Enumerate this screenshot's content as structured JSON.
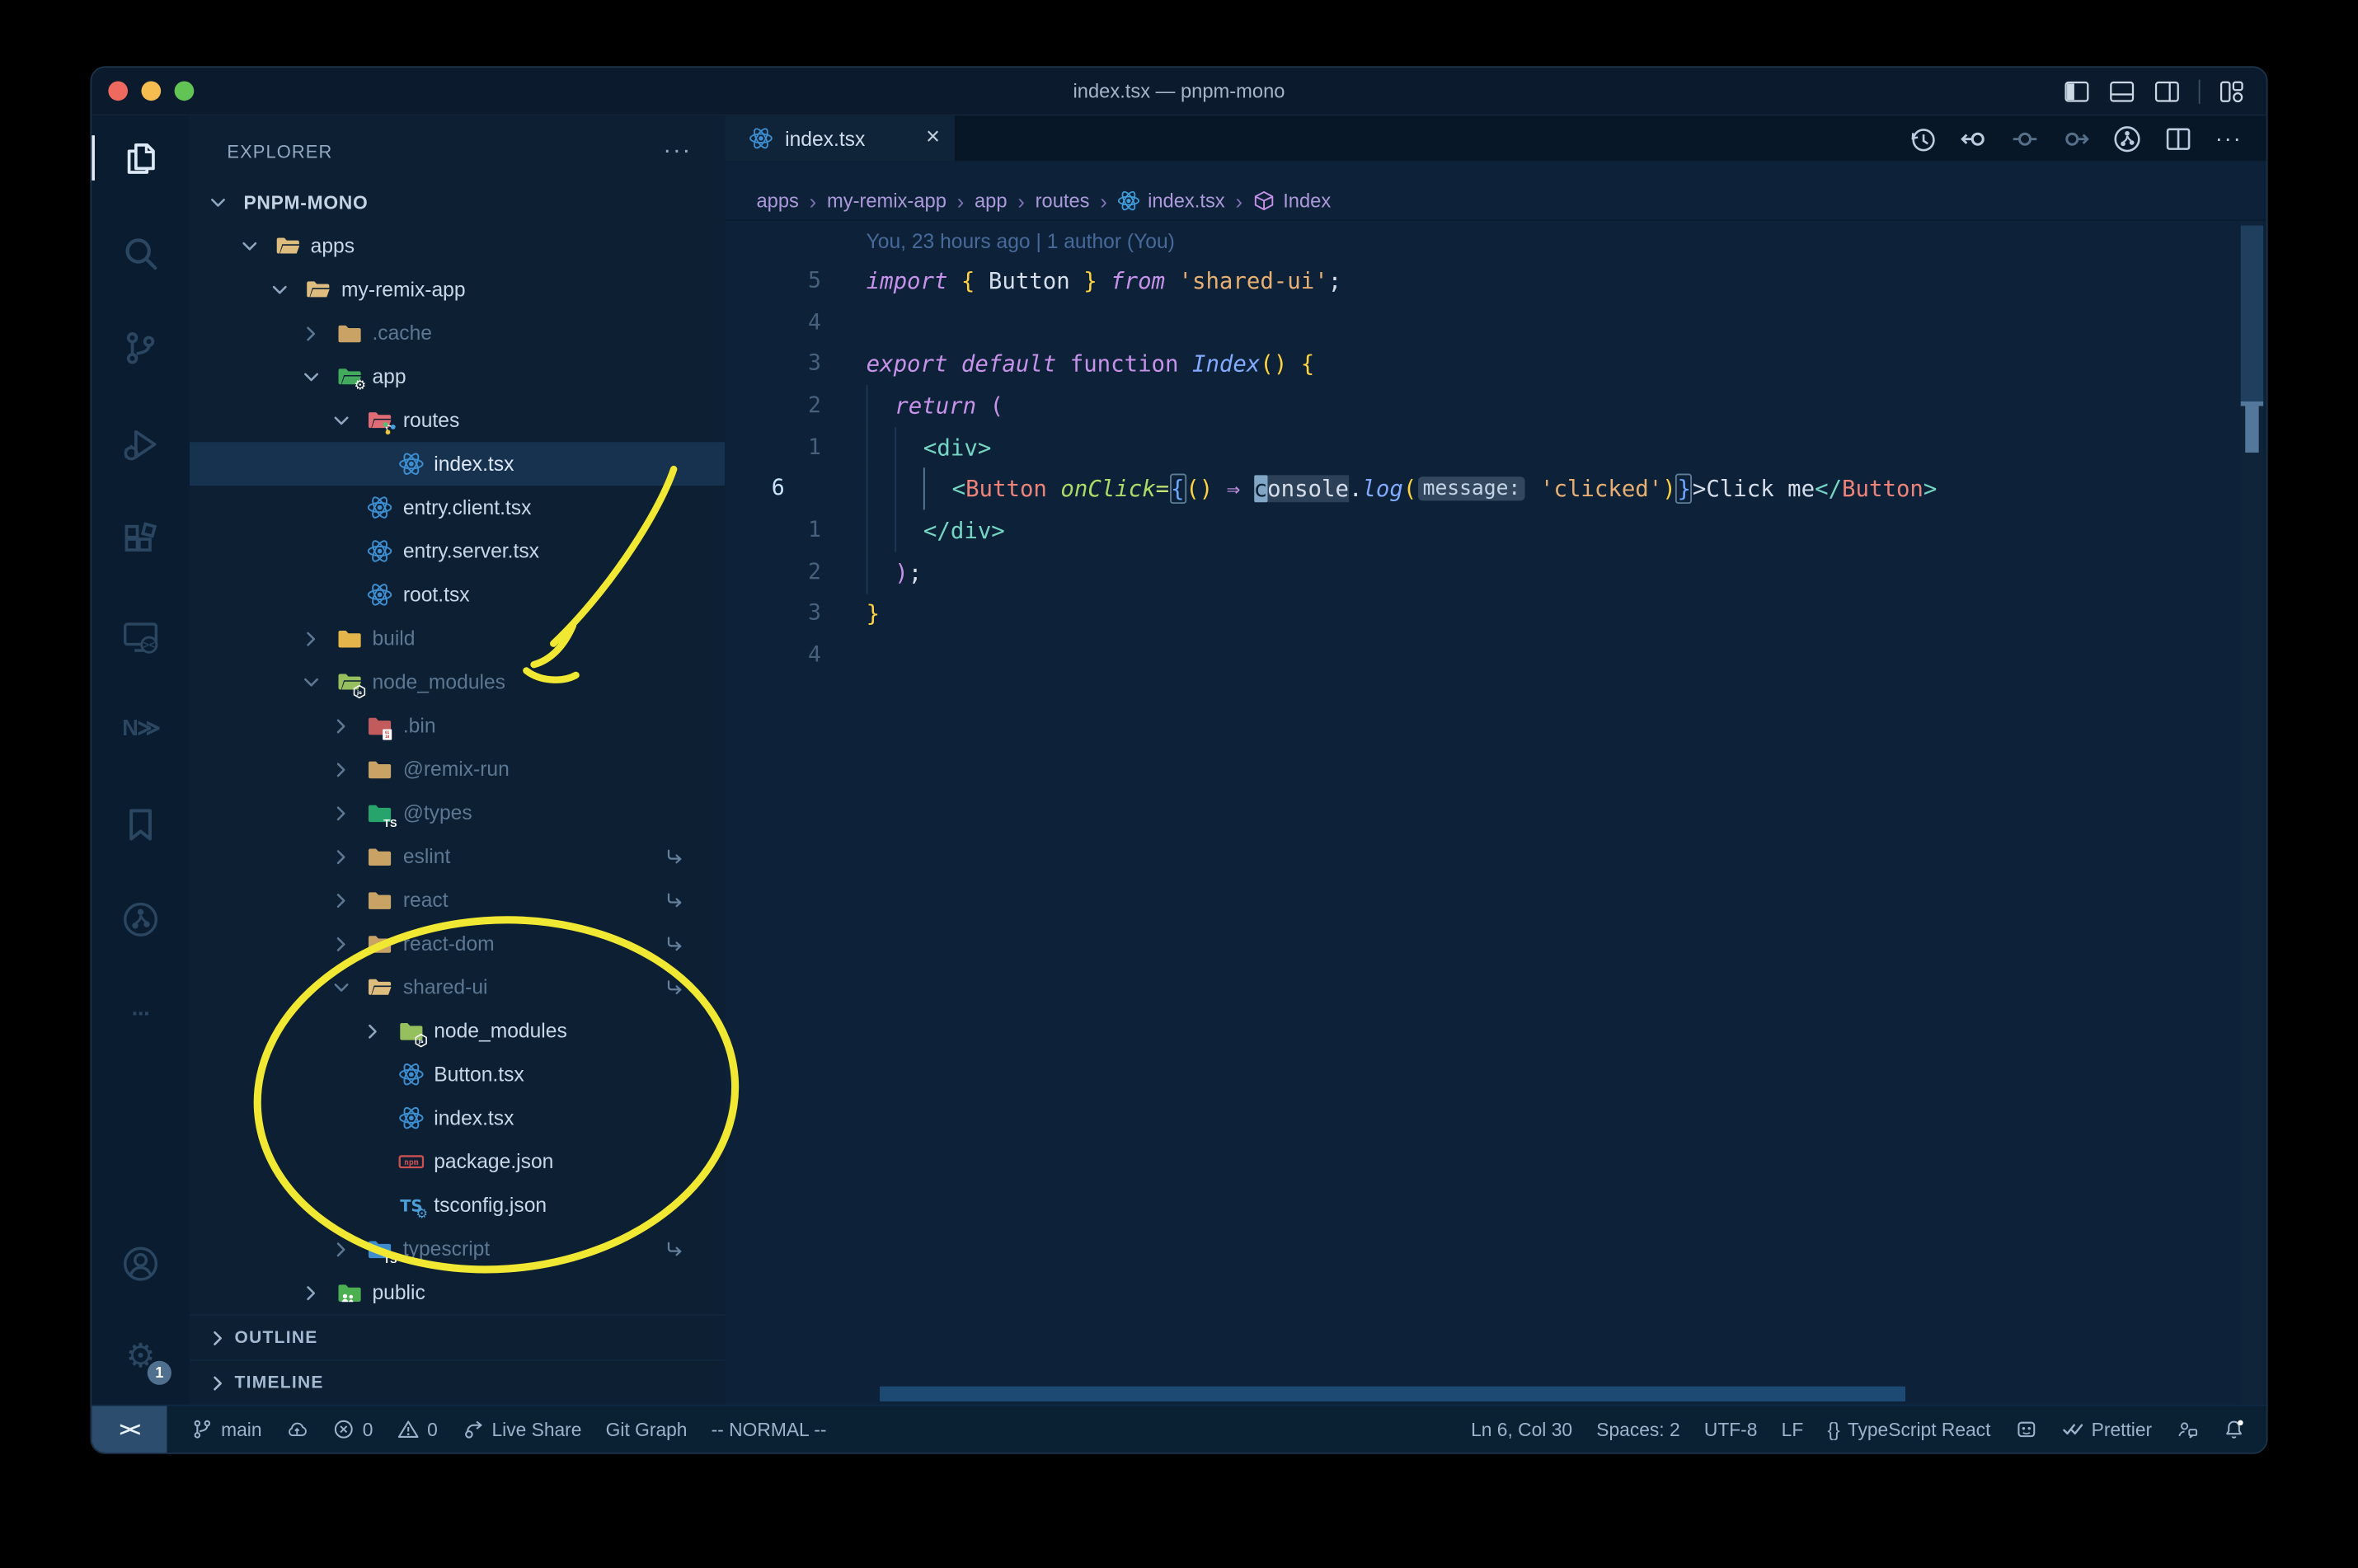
{
  "window": {
    "title": "index.tsx — pnpm-mono",
    "traffic_lights": [
      "close",
      "minimize",
      "zoom"
    ],
    "layout_controls": [
      {
        "name": "toggle-primary-sidebar",
        "icon": "panel-left"
      },
      {
        "name": "toggle-panel",
        "icon": "panel-bottom"
      },
      {
        "name": "toggle-secondary-sidebar",
        "icon": "panel-right"
      },
      {
        "name": "customize-layout",
        "icon": "layout"
      }
    ]
  },
  "activity_bar": {
    "items": [
      {
        "name": "explorer",
        "icon": "files",
        "active": true
      },
      {
        "name": "search",
        "icon": "search",
        "active": false
      },
      {
        "name": "source-control",
        "icon": "scm",
        "active": false
      },
      {
        "name": "run-and-debug",
        "icon": "debug",
        "active": false
      },
      {
        "name": "extensions",
        "icon": "extensions",
        "active": false
      },
      {
        "name": "remote-explorer",
        "icon": "remote",
        "active": false
      },
      {
        "name": "nx-console",
        "icon": "nx",
        "active": false,
        "text": "N≫"
      },
      {
        "name": "bookmarks",
        "icon": "bookmark",
        "active": false
      },
      {
        "name": "gitlens",
        "icon": "gitlens",
        "active": false
      },
      {
        "name": "additional-views",
        "icon": "ellipsis",
        "active": false
      }
    ],
    "bottom_items": [
      {
        "name": "accounts",
        "icon": "account"
      },
      {
        "name": "settings",
        "icon": "gear",
        "badge": "1"
      }
    ]
  },
  "sidebar": {
    "title": "EXPLORER",
    "tree": [
      {
        "label": "PNPM-MONO",
        "level": 0,
        "chevron": "down",
        "root": true
      },
      {
        "label": "apps",
        "level": 1,
        "chevron": "down",
        "icon": {
          "base": "folder-open",
          "color": "#debc7d"
        }
      },
      {
        "label": "my-remix-app",
        "level": 2,
        "chevron": "down",
        "icon": {
          "base": "folder-open",
          "color": "#debc7d"
        }
      },
      {
        "label": ".cache",
        "level": 3,
        "chevron": "right",
        "dim": true,
        "icon": {
          "base": "folder",
          "color": "#c9a265"
        }
      },
      {
        "label": "app",
        "level": 3,
        "chevron": "down",
        "icon": {
          "base": "folder-open",
          "color": "#43a95c",
          "badge": "gear"
        }
      },
      {
        "label": "routes",
        "level": 4,
        "chevron": "down",
        "icon": {
          "base": "folder-open",
          "color": "#e06c75",
          "badge": "routes"
        }
      },
      {
        "label": "index.tsx",
        "level": 5,
        "chevron": "none",
        "selected": true,
        "icon": {
          "base": "react",
          "color": "#3d8fd1"
        }
      },
      {
        "label": "entry.client.tsx",
        "level": 4,
        "chevron": "none",
        "icon": {
          "base": "react",
          "color": "#3d8fd1"
        }
      },
      {
        "label": "entry.server.tsx",
        "level": 4,
        "chevron": "none",
        "icon": {
          "base": "react",
          "color": "#3d8fd1"
        }
      },
      {
        "label": "root.tsx",
        "level": 4,
        "chevron": "none",
        "icon": {
          "base": "react",
          "color": "#3d8fd1"
        }
      },
      {
        "label": "build",
        "level": 3,
        "chevron": "right",
        "dim": true,
        "icon": {
          "base": "folder",
          "color": "#e3b54b"
        }
      },
      {
        "label": "node_modules",
        "level": 3,
        "chevron": "down",
        "dim": true,
        "icon": {
          "base": "folder-open",
          "color": "#96c05e",
          "badge": "js"
        }
      },
      {
        "label": ".bin",
        "level": 4,
        "chevron": "right",
        "dim": true,
        "icon": {
          "base": "folder",
          "color": "#c25b5b",
          "badge": "binary"
        }
      },
      {
        "label": "@remix-run",
        "level": 4,
        "chevron": "right",
        "dim": true,
        "icon": {
          "base": "folder",
          "color": "#c9a265"
        }
      },
      {
        "label": "@types",
        "level": 4,
        "chevron": "right",
        "dim": true,
        "icon": {
          "base": "folder",
          "color": "#27a36c",
          "badge": "ts"
        }
      },
      {
        "label": "eslint",
        "level": 4,
        "chevron": "right",
        "dim": true,
        "symlink": true,
        "icon": {
          "base": "folder",
          "color": "#c9a265"
        }
      },
      {
        "label": "react",
        "level": 4,
        "chevron": "right",
        "dim": true,
        "symlink": true,
        "icon": {
          "base": "folder",
          "color": "#c9a265"
        }
      },
      {
        "label": "react-dom",
        "level": 4,
        "chevron": "right",
        "dim": true,
        "symlink": true,
        "icon": {
          "base": "folder",
          "color": "#c9a265"
        }
      },
      {
        "label": "shared-ui",
        "level": 4,
        "chevron": "down",
        "dim": true,
        "symlink": true,
        "icon": {
          "base": "folder-open",
          "color": "#debc7d"
        }
      },
      {
        "label": "node_modules",
        "level": 5,
        "chevron": "right",
        "icon": {
          "base": "folder",
          "color": "#96c05e",
          "badge": "js"
        }
      },
      {
        "label": "Button.tsx",
        "level": 5,
        "chevron": "none",
        "icon": {
          "base": "react",
          "color": "#3d8fd1"
        }
      },
      {
        "label": "index.tsx",
        "level": 5,
        "chevron": "none",
        "icon": {
          "base": "react",
          "color": "#3d8fd1"
        }
      },
      {
        "label": "package.json",
        "level": 5,
        "chevron": "none",
        "icon": {
          "base": "npm",
          "color": "#cb5151"
        }
      },
      {
        "label": "tsconfig.json",
        "level": 5,
        "chevron": "none",
        "icon": {
          "base": "tsletters",
          "color": "#4d9fd6",
          "badge": "gear-blue"
        }
      },
      {
        "label": "typescript",
        "level": 4,
        "chevron": "right",
        "dim": true,
        "symlink": true,
        "icon": {
          "base": "folder",
          "color": "#3f8ccc",
          "badge": "ts"
        }
      },
      {
        "label": "public",
        "level": 3,
        "chevron": "right",
        "icon": {
          "base": "folder",
          "color": "#4caf50",
          "badge": "people"
        }
      }
    ],
    "sections": [
      {
        "label": "OUTLINE"
      },
      {
        "label": "TIMELINE"
      }
    ]
  },
  "editor": {
    "tab": {
      "label": "index.tsx",
      "close": "×"
    },
    "actions": [
      {
        "name": "local-history",
        "icon": "history",
        "dim": false
      },
      {
        "name": "previous-change",
        "icon": "chg-prev",
        "dim": false
      },
      {
        "name": "open-changes",
        "icon": "chg",
        "dim": true
      },
      {
        "name": "next-change",
        "icon": "chg-next",
        "dim": true
      },
      {
        "name": "gitlens-graph",
        "icon": "gitlens",
        "dim": false
      },
      {
        "name": "split-editor",
        "icon": "split",
        "dim": false
      },
      {
        "name": "more-actions",
        "icon": "ellipsis",
        "dim": false
      }
    ],
    "breadcrumbs": [
      {
        "label": "apps"
      },
      {
        "label": "my-remix-app"
      },
      {
        "label": "app"
      },
      {
        "label": "routes"
      },
      {
        "label": "index.tsx",
        "icon": "react"
      },
      {
        "label": "Index",
        "icon": "cube"
      }
    ],
    "blame": "You, 23 hours ago | 1 author (You)",
    "code": [
      {
        "num": "5",
        "guides": 0,
        "tokens": [
          [
            "import",
            "kw"
          ],
          [
            " ",
            "pl"
          ],
          [
            "{",
            "by"
          ],
          [
            " ",
            "pl"
          ],
          [
            "Button",
            "pl"
          ],
          [
            " ",
            "pl"
          ],
          [
            "}",
            "by"
          ],
          [
            " ",
            "pl"
          ],
          [
            "from",
            "kw"
          ],
          [
            " ",
            "pl"
          ],
          [
            "'shared-ui'",
            "str"
          ],
          [
            ";",
            "pl"
          ]
        ]
      },
      {
        "num": "4",
        "guides": 0,
        "tokens": []
      },
      {
        "num": "3",
        "guides": 0,
        "tokens": [
          [
            "export",
            "kw"
          ],
          [
            " ",
            "pl"
          ],
          [
            "default",
            "kw"
          ],
          [
            " ",
            "pl"
          ],
          [
            "function",
            "kwf"
          ],
          [
            " ",
            "pl"
          ],
          [
            "Index",
            "fn"
          ],
          [
            "()",
            "by"
          ],
          [
            " ",
            "pl"
          ],
          [
            "{",
            "by"
          ]
        ]
      },
      {
        "num": "2",
        "guides": 1,
        "tokens": [
          [
            "return",
            "kw"
          ],
          [
            " ",
            "pl"
          ],
          [
            "(",
            "bm"
          ]
        ]
      },
      {
        "num": "1",
        "guides": 2,
        "tokens": [
          [
            "<div>",
            "tag"
          ]
        ]
      },
      {
        "num": "6",
        "current": true,
        "guides": 3,
        "tokens": [
          [
            "<",
            "tag"
          ],
          [
            "Button",
            "cmp"
          ],
          [
            " ",
            "pl"
          ],
          [
            "onClick",
            "attr"
          ],
          [
            "=",
            "eq"
          ],
          [
            "{",
            "bbx"
          ],
          [
            "()",
            "by"
          ],
          [
            " ",
            "pl"
          ],
          [
            "⇒",
            "arrow"
          ],
          [
            " ",
            "pl"
          ],
          [
            "c",
            "cursor"
          ],
          [
            "onsole",
            "whl"
          ],
          [
            ".",
            "pl"
          ],
          [
            "log",
            "fn"
          ],
          [
            "(",
            "by"
          ],
          [
            "message:",
            "inlay"
          ],
          [
            " ",
            "pl"
          ],
          [
            "'clicked'",
            "str"
          ],
          [
            ")",
            "by"
          ],
          [
            "}",
            "bbx"
          ],
          [
            ">",
            "pl"
          ],
          [
            "Click me",
            "pl"
          ],
          [
            "</",
            "tag"
          ],
          [
            "Button",
            "cmp"
          ],
          [
            ">",
            "tag"
          ]
        ]
      },
      {
        "num": "1",
        "guides": 2,
        "tokens": [
          [
            "</div>",
            "tag"
          ]
        ]
      },
      {
        "num": "2",
        "guides": 1,
        "tokens": [
          [
            ")",
            "bm"
          ],
          [
            ";",
            "pl"
          ]
        ]
      },
      {
        "num": "3",
        "guides": 0,
        "tokens": [
          [
            "}",
            "by"
          ]
        ]
      },
      {
        "num": "4",
        "guides": 0,
        "tokens": []
      }
    ]
  },
  "status_bar": {
    "left": [
      {
        "name": "remote",
        "icon": "remote-indicator",
        "label": "><",
        "box": true
      },
      {
        "name": "git-branch",
        "icon": "branch",
        "label": "main"
      },
      {
        "name": "publish-changes",
        "icon": "cloud-upload",
        "label": ""
      },
      {
        "name": "errors",
        "icon": "error-circle",
        "label": "0"
      },
      {
        "name": "warnings",
        "icon": "warning-triangle",
        "label": "0"
      },
      {
        "name": "live-share",
        "icon": "live-share",
        "label": "Live Share"
      },
      {
        "name": "git-graph",
        "icon": "",
        "label": "Git Graph"
      },
      {
        "name": "vim-mode",
        "icon": "",
        "label": "-- NORMAL --"
      }
    ],
    "right": [
      {
        "name": "cursor-position",
        "icon": "",
        "label": "Ln 6, Col 30"
      },
      {
        "name": "indentation",
        "icon": "",
        "label": "Spaces: 2"
      },
      {
        "name": "encoding",
        "icon": "",
        "label": "UTF-8"
      },
      {
        "name": "eol",
        "icon": "",
        "label": "LF"
      },
      {
        "name": "language-mode",
        "icon": "braces",
        "label": "TypeScript React"
      },
      {
        "name": "extension",
        "icon": "robot",
        "label": ""
      },
      {
        "name": "formatter",
        "icon": "double-check",
        "label": "Prettier"
      },
      {
        "name": "feedback",
        "icon": "feedback",
        "label": ""
      },
      {
        "name": "notifications",
        "icon": "bell-dot",
        "label": ""
      }
    ]
  },
  "annotations": {
    "color": "#f0e832",
    "shapes": [
      "arrow-to-node-modules",
      "ellipse-around-shared-ui"
    ]
  },
  "colors": {
    "editor_bg": "#0d2238",
    "sidebar_bg": "#0c1f33",
    "activity_bg": "#0a1c2f",
    "status_bg": "#0a2033",
    "selected_row": "#17324e",
    "keyword": "#c792ea",
    "function_name": "#82aaff",
    "component": "#ee837a",
    "attribute": "#addb67",
    "string": "#e8af73",
    "tag_punct": "#76d6c4",
    "bracket_yellow": "#ffd23f",
    "bracket_blue": "#6fa8ff",
    "text": "#d6deeb",
    "line_number": "#47617c",
    "line_number_active": "#c9e6ff",
    "blame": "#486a9a",
    "breadcrumb": "#ab99da",
    "annotation_yellow": "#f0e832",
    "remote_box": "#2d4d6e",
    "react_icon": "#3d8fd1",
    "folder_tan": "#debc7d"
  }
}
